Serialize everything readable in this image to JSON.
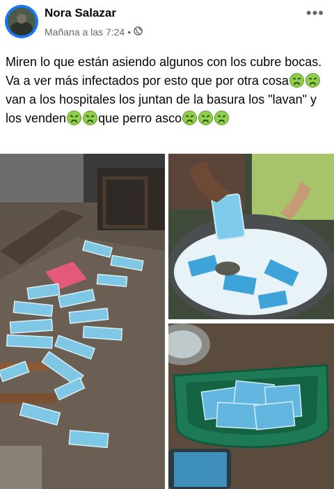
{
  "post": {
    "author": "Nora Salazar",
    "timestamp": "Mañana a las 7:24",
    "separator": "•",
    "audience_icon": "globe-icon",
    "more_icon": "more-options-icon",
    "text_parts": {
      "p1": "Miren lo que están asiendo algunos con los cubre bocas. Va a ver más infectados por esto que por otra cosa",
      "p2": "van a los hospitales los juntan de la basura los \"lavan\" y los venden",
      "p3": "que perro asco"
    },
    "emoji_name": "nauseated-face-emoji"
  },
  "photos": [
    {
      "name": "photo-discarded-masks-floor"
    },
    {
      "name": "photo-masks-washing-tub"
    },
    {
      "name": "photo-masks-green-basin"
    }
  ],
  "colors": {
    "mask_blue": "#7ec8e6",
    "facebook_blue": "#1877f2",
    "meta_gray": "#65676b"
  }
}
